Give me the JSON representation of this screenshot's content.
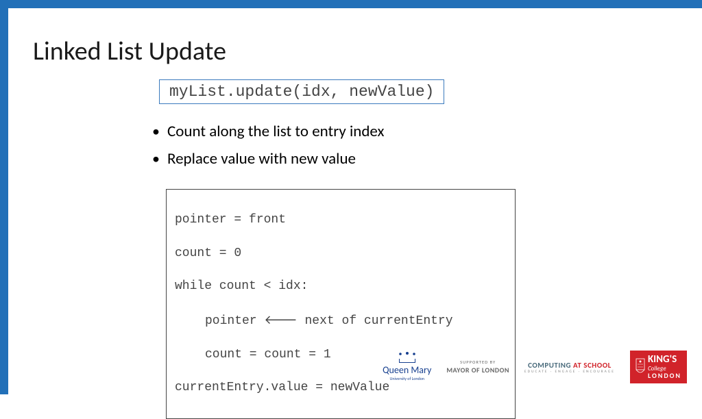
{
  "title": "Linked List Update",
  "method_signature": "myList.update(idx, newValue)",
  "bullets": [
    "Count along the list to entry index",
    "Replace value with new value"
  ],
  "code": {
    "line1": "pointer = front",
    "line2": "count = 0",
    "line3": "while count < idx:",
    "line4_pre": "pointer ",
    "line4_arrow": "🡐",
    "line4_post": " next of currentEntry",
    "line5": "count = count = 1",
    "line6": "currentEntry.value = newValue"
  },
  "footer": {
    "qm_name": "Queen Mary",
    "qm_sub": "University of London",
    "mayor_sup": "SUPPORTED BY",
    "mayor_main": "MAYOR OF LONDON",
    "cas_comp": "COMPUTING",
    "cas_at": " AT SCHOOL",
    "cas_sub": "EDUCATE · ENGAGE · ENCOURAGE",
    "kcl_king": "KING'S",
    "kcl_college": "College",
    "kcl_london": "LONDON"
  }
}
